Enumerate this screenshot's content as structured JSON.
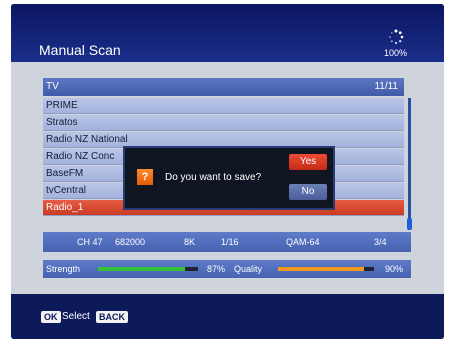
{
  "header": {
    "title": "Manual Scan",
    "progress_label": "100%"
  },
  "list": {
    "title": "TV",
    "count": "11/11",
    "items": [
      {
        "label": "PRIME",
        "selected": false
      },
      {
        "label": "Stratos",
        "selected": false
      },
      {
        "label": "Radio NZ National",
        "selected": false
      },
      {
        "label": "Radio NZ Conc",
        "selected": false
      },
      {
        "label": "BaseFM",
        "selected": false
      },
      {
        "label": "tvCentral",
        "selected": false
      },
      {
        "label": "Radio_1",
        "selected": true
      }
    ]
  },
  "dialog": {
    "icon": "?",
    "message": "Do you want to save?",
    "yes_label": "Yes",
    "no_label": "No"
  },
  "info": {
    "channel": "CH 47",
    "frequency": "682000",
    "mode": "8K",
    "guard": "1/16",
    "modulation": "QAM-64",
    "code_rate": "3/4"
  },
  "signal": {
    "strength_label": "Strength",
    "strength_value": "87%",
    "strength_fraction": 0.87,
    "quality_label": "Quality",
    "quality_value": "90%",
    "quality_fraction": 0.9,
    "strength_color": "#35c13a",
    "quality_color": "#f29a1f"
  },
  "footer": {
    "ok_key": "OK",
    "ok_label": "Select",
    "back_key": "BACK"
  },
  "colors": {
    "accent": "#e55d44",
    "header_blue": "#1a2e8a"
  }
}
